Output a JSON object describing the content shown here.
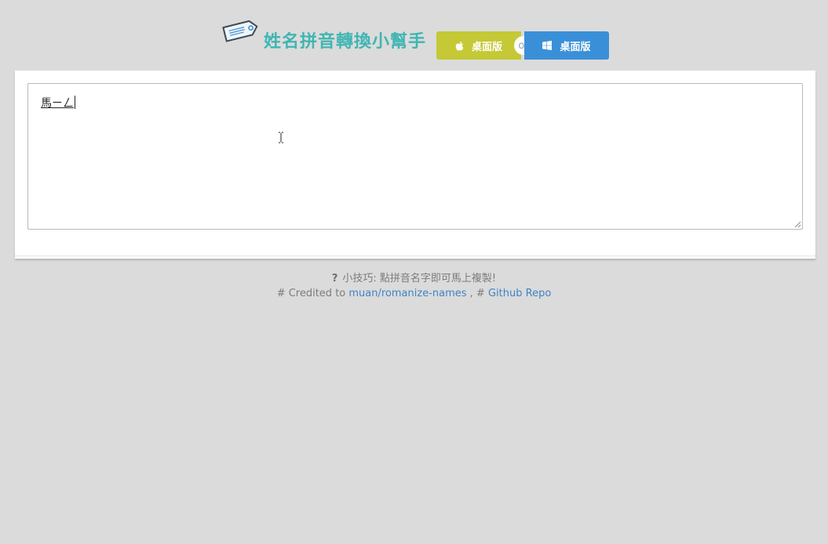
{
  "header": {
    "icon": "tag-icon",
    "title": "姓名拼音轉換小幫手",
    "mac_button": {
      "icon": "apple-icon",
      "label": "桌面版",
      "color": "#c4c935"
    },
    "separator": "or",
    "windows_button": {
      "icon": "windows-icon",
      "label": "桌面版",
      "color": "#3a90d8"
    },
    "title_color": "#3fb6b2"
  },
  "editor": {
    "value": "馬ㄧㄥ"
  },
  "footer": {
    "tip_icon": "?",
    "tip_text": "小技巧: 點拼音名字即可馬上複製!",
    "credit_prefix": "# Credited to",
    "credit_link": "muan/romanize-names",
    "credit_separator": ", #",
    "repo_link": "Github Repo",
    "link_color": "#3f83c8"
  }
}
